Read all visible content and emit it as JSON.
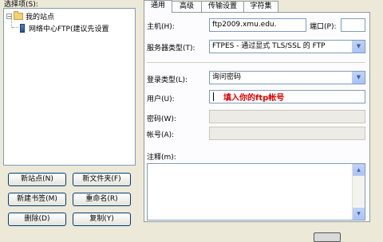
{
  "left": {
    "select_label": "选择项(S):",
    "tree": {
      "root_label": "我的站点",
      "child_label": "网络中心FTP(建议先设置"
    },
    "buttons": {
      "new_site": "新站点(N)",
      "new_folder": "新文件夹(F)",
      "new_bookmark": "新建书签(M)",
      "rename": "重命名(R)",
      "delete": "删除(D)",
      "copy": "复制(Y)"
    }
  },
  "tabs": [
    "通用",
    "高级",
    "传输设置",
    "字符集"
  ],
  "general": {
    "host_label": "主机(H):",
    "host_value": "ftp2009.xmu.edu.",
    "port_label": "端口(P):",
    "port_value": "",
    "server_type_label": "服务器类型(T):",
    "server_type_value": "FTPES - 通过显式 TLS/SSL 的 FTP",
    "logon_type_label": "登录类型(L):",
    "logon_type_value": "询问密码",
    "user_label": "用户(U):",
    "user_value": "",
    "password_label": "密码(W):",
    "account_label": "帐号(A):",
    "comments_label": "注释(m):"
  },
  "annotation": "填入你的ftp帐号",
  "colors": {
    "annotation": "#e00000",
    "window_bg": "#ece9d8",
    "tab_page_bg": "#fcfcfe"
  },
  "icons": {
    "folder": "folder-icon",
    "site": "ftp-site-icon",
    "dropdown": "chevron-down-icon",
    "scroll_up": "arrow-up-icon",
    "scroll_down": "arrow-down-icon"
  }
}
